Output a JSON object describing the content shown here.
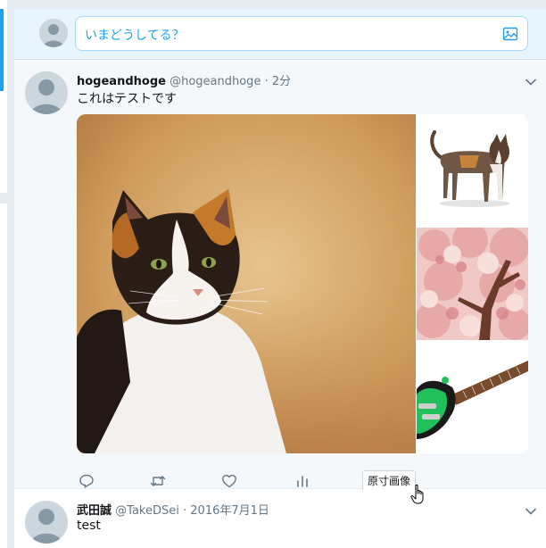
{
  "compose": {
    "placeholder": "いまどうしてる？",
    "media_icon": "image-icon"
  },
  "tweets": [
    {
      "name": "hogeandhoge",
      "screen_name": "@hogeandhoge",
      "separator": "·",
      "time": "2分",
      "text": "これはテストです",
      "media": [
        {
          "icon": "calico-cat-photo"
        },
        {
          "icon": "standing-cat-photo"
        },
        {
          "icon": "cherry-blossom-photo"
        },
        {
          "icon": "electric-guitar-photo"
        }
      ],
      "actions": {
        "reply_icon": "reply-icon",
        "retweet_icon": "retweet-icon",
        "like_icon": "heart-icon",
        "analytics_icon": "analytics-icon",
        "original_size_label": "原寸画像"
      }
    },
    {
      "name": "武田誠",
      "screen_name": "@TakeDSei",
      "separator": "·",
      "time": "2016年7月1日",
      "text": "test"
    }
  ],
  "colors": {
    "accent": "#1da1f2",
    "compose_bg": "#e8f5fd",
    "tweet_selected_bg": "#f5f8fa",
    "page_bg": "#e6ecf0",
    "muted_text": "#657786"
  }
}
